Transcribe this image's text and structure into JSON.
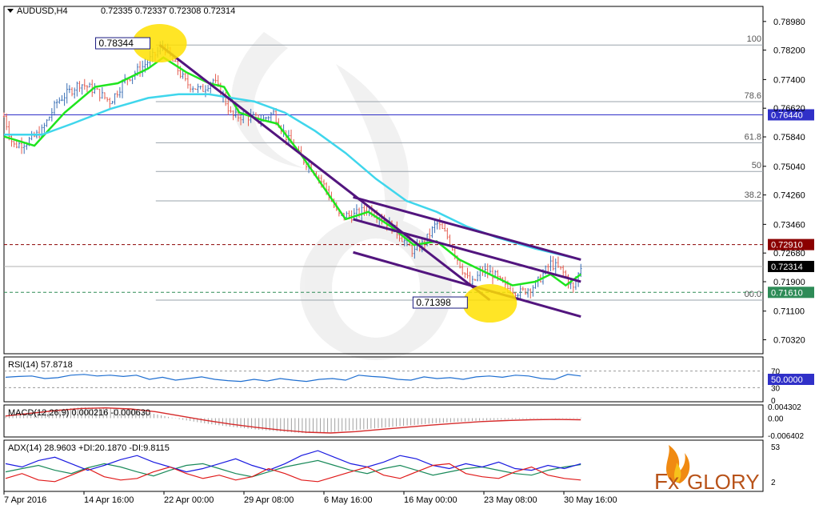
{
  "colors": {
    "background": "#ffffff",
    "frame": "#000000",
    "candle_up": "#3a6fb5",
    "candle_down": "#e45c4f",
    "ma_fast": "#1ee51e",
    "ma_slow": "#3fd6ec",
    "channel": "#52157e",
    "fib_line": "#9aa3ab",
    "resistance": "#8b0000",
    "support": "#2e8b57",
    "level_blue": "#3030c8",
    "highlight": "#ffe000",
    "rsi": "#1f6fd1",
    "macd_hist": "#a0a0a0",
    "macd_signal": "#d62a2a",
    "adx_main": "#1a8a5a",
    "plus_di": "#1a1ae0",
    "minus_di": "#e01a1a"
  },
  "header": {
    "menu_icon": "triangle-down-icon",
    "symbol": "AUDUSD,H4",
    "ohlc": "0.72335 0.72337 0.72308 0.72314"
  },
  "chart_data": [
    {
      "type": "candlestick",
      "title": "AUDUSD,H4",
      "x_labels": [
        "7 Apr 2016",
        "14 Apr 16:00",
        "22 Apr 00:00",
        "29 Apr 08:00",
        "6 May 16:00",
        "16 May 00:00",
        "23 May 08:00",
        "30 May 16:00"
      ],
      "ylim": [
        0.6994,
        0.7939
      ],
      "y_ticks": [
        "0.78980",
        "0.78200",
        "0.77400",
        "0.76620",
        "0.75840",
        "0.75040",
        "0.74260",
        "0.73460",
        "0.72680",
        "0.71900",
        "0.71100",
        "0.70320"
      ],
      "price_path": [
        [
          0.0,
          0.764
        ],
        [
          0.012,
          0.756
        ],
        [
          0.03,
          0.757
        ],
        [
          0.05,
          0.76
        ],
        [
          0.07,
          0.768
        ],
        [
          0.1,
          0.773
        ],
        [
          0.12,
          0.771
        ],
        [
          0.14,
          0.768
        ],
        [
          0.16,
          0.774
        ],
        [
          0.18,
          0.777
        ],
        [
          0.2,
          0.781
        ],
        [
          0.21,
          0.7834
        ],
        [
          0.225,
          0.778
        ],
        [
          0.24,
          0.773
        ],
        [
          0.26,
          0.771
        ],
        [
          0.275,
          0.774
        ],
        [
          0.29,
          0.769
        ],
        [
          0.3,
          0.764
        ],
        [
          0.32,
          0.764
        ],
        [
          0.34,
          0.763
        ],
        [
          0.355,
          0.765
        ],
        [
          0.37,
          0.759
        ],
        [
          0.39,
          0.753
        ],
        [
          0.41,
          0.749
        ],
        [
          0.425,
          0.744
        ],
        [
          0.44,
          0.737
        ],
        [
          0.46,
          0.737
        ],
        [
          0.48,
          0.739
        ],
        [
          0.5,
          0.736
        ],
        [
          0.52,
          0.732
        ],
        [
          0.54,
          0.727
        ],
        [
          0.555,
          0.73
        ],
        [
          0.57,
          0.735
        ],
        [
          0.585,
          0.731
        ],
        [
          0.6,
          0.724
        ],
        [
          0.615,
          0.718
        ],
        [
          0.63,
          0.722
        ],
        [
          0.645,
          0.721
        ],
        [
          0.66,
          0.7175
        ],
        [
          0.68,
          0.716
        ],
        [
          0.7,
          0.718
        ],
        [
          0.72,
          0.724
        ],
        [
          0.735,
          0.722
        ],
        [
          0.75,
          0.717
        ],
        [
          0.76,
          0.7231
        ]
      ],
      "series": [
        {
          "name": "",
          "values": [
            [
              0.0,
              0.7585
            ],
            [
              0.04,
              0.756
            ],
            [
              0.08,
              0.765
            ],
            [
              0.12,
              0.772
            ],
            [
              0.15,
              0.773
            ],
            [
              0.19,
              0.777
            ],
            [
              0.21,
              0.78
            ],
            [
              0.24,
              0.776
            ],
            [
              0.27,
              0.773
            ],
            [
              0.29,
              0.772
            ],
            [
              0.31,
              0.765
            ],
            [
              0.34,
              0.763
            ],
            [
              0.36,
              0.762
            ],
            [
              0.39,
              0.754
            ],
            [
              0.42,
              0.745
            ],
            [
              0.45,
              0.736
            ],
            [
              0.48,
              0.738
            ],
            [
              0.51,
              0.734
            ],
            [
              0.54,
              0.729
            ],
            [
              0.57,
              0.73
            ],
            [
              0.6,
              0.725
            ],
            [
              0.63,
              0.722
            ],
            [
              0.65,
              0.72
            ],
            [
              0.67,
              0.718
            ],
            [
              0.7,
              0.719
            ],
            [
              0.72,
              0.721
            ],
            [
              0.74,
              0.718
            ],
            [
              0.76,
              0.721
            ]
          ]
        },
        {
          "name": "",
          "values": [
            [
              0.0,
              0.759
            ],
            [
              0.05,
              0.759
            ],
            [
              0.09,
              0.762
            ],
            [
              0.14,
              0.766
            ],
            [
              0.19,
              0.769
            ],
            [
              0.23,
              0.77
            ],
            [
              0.27,
              0.77
            ],
            [
              0.3,
              0.769
            ],
            [
              0.33,
              0.768
            ],
            [
              0.37,
              0.765
            ],
            [
              0.41,
              0.76
            ],
            [
              0.45,
              0.754
            ],
            [
              0.49,
              0.747
            ],
            [
              0.53,
              0.741
            ],
            [
              0.57,
              0.738
            ],
            [
              0.61,
              0.734
            ],
            [
              0.65,
              0.731
            ],
            [
              0.7,
              0.728
            ],
            [
              0.74,
              0.726
            ],
            [
              0.76,
              0.725
            ]
          ]
        }
      ],
      "fibonacci": {
        "levels": [
          {
            "label": "100",
            "price": 0.7834
          },
          {
            "label": "78.6",
            "price": 0.768
          },
          {
            "label": "61.8",
            "price": 0.7568
          },
          {
            "label": "50",
            "price": 0.749
          },
          {
            "label": "38.2",
            "price": 0.741
          },
          {
            "label": "00.0",
            "price": 0.714
          }
        ]
      },
      "horizontal_levels": [
        {
          "label": "0.76440",
          "price": 0.7644,
          "style": "solid",
          "color_key": "level_blue"
        },
        {
          "label": "0.72910",
          "price": 0.7291,
          "style": "dashed",
          "color_key": "resistance"
        },
        {
          "label": "0.72314",
          "price": 0.72314,
          "style": "current",
          "color_key": "frame"
        },
        {
          "label": "0.71610",
          "price": 0.7161,
          "style": "dashed",
          "color_key": "support"
        }
      ],
      "annotations": [
        {
          "text": "0.78344",
          "x": 0.205,
          "price": 0.78344
        },
        {
          "text": "0.71398",
          "x": 0.64,
          "price": 0.71398
        }
      ]
    },
    {
      "type": "line",
      "title": "RSI(14) 57.8718",
      "ylim": [
        0,
        100
      ],
      "y_ticks": [
        "70",
        "50.0000",
        "30",
        "0"
      ],
      "series": [
        {
          "name": "",
          "values": [
            55,
            57,
            58,
            52,
            54,
            60,
            62,
            58,
            60,
            57,
            60,
            50,
            55,
            48,
            52,
            56,
            50,
            47,
            45,
            50,
            46,
            52,
            48,
            45,
            50,
            52,
            48,
            60,
            57,
            55,
            50,
            48,
            56,
            52,
            54,
            50,
            56,
            58,
            55,
            60,
            58,
            52,
            50,
            62,
            58
          ]
        }
      ]
    },
    {
      "type": "line",
      "title": "MACD(12,26,9) 0.000216 -0.000630",
      "ylim": [
        -0.0064,
        0.0043
      ],
      "y_ticks": [
        "0.004302",
        "0.00",
        "-0.006402"
      ],
      "series": [
        {
          "name": "",
          "values": [
            0.001,
            0.0022,
            0.0032,
            0.004,
            0.0038,
            0.003,
            0.0015,
            -0.0005,
            -0.002,
            -0.0032,
            -0.0042,
            -0.005,
            -0.0056,
            -0.0052,
            -0.0044,
            -0.0036,
            -0.0028,
            -0.002,
            -0.0014,
            -0.0009,
            -0.0005,
            -0.0002,
            0.0001,
            0.0002
          ]
        },
        {
          "name": "",
          "values": [
            0.0008,
            0.0018,
            0.0028,
            0.0036,
            0.0038,
            0.0034,
            0.0024,
            0.0008,
            -0.0008,
            -0.0022,
            -0.0034,
            -0.0044,
            -0.0052,
            -0.0055,
            -0.005,
            -0.0042,
            -0.0034,
            -0.0026,
            -0.0019,
            -0.0013,
            -0.0009,
            -0.0006,
            -0.0005,
            -0.0006
          ]
        }
      ]
    },
    {
      "type": "line",
      "title": "ADX(14) 28.9603 +DI:20.1870 -DI:9.8115",
      "ylim": [
        0,
        53
      ],
      "y_ticks": [
        "53",
        "2"
      ],
      "series": [
        {
          "name": "",
          "values": [
            20,
            24,
            28,
            22,
            18,
            25,
            30,
            26,
            20,
            15,
            22,
            28,
            30,
            24,
            18,
            14,
            20,
            26,
            30,
            34,
            28,
            22,
            18,
            24,
            28,
            22,
            16,
            20,
            24,
            26,
            22,
            18,
            16,
            22,
            26,
            29
          ]
        },
        {
          "name": "",
          "values": [
            30,
            26,
            34,
            38,
            30,
            22,
            28,
            35,
            40,
            32,
            26,
            20,
            24,
            30,
            36,
            28,
            22,
            30,
            40,
            46,
            38,
            30,
            26,
            32,
            40,
            36,
            28,
            24,
            30,
            26,
            32,
            24,
            22,
            28,
            24,
            30
          ]
        },
        {
          "name": "",
          "values": [
            12,
            18,
            10,
            8,
            16,
            24,
            14,
            10,
            12,
            20,
            26,
            18,
            12,
            16,
            10,
            14,
            24,
            18,
            10,
            8,
            14,
            20,
            26,
            16,
            12,
            20,
            28,
            30,
            18,
            14,
            12,
            20,
            26,
            16,
            12,
            10
          ]
        }
      ]
    }
  ],
  "logo": {
    "text_prefix": "Fx",
    "text_main": "GLORY",
    "icon": "flame-icon"
  }
}
